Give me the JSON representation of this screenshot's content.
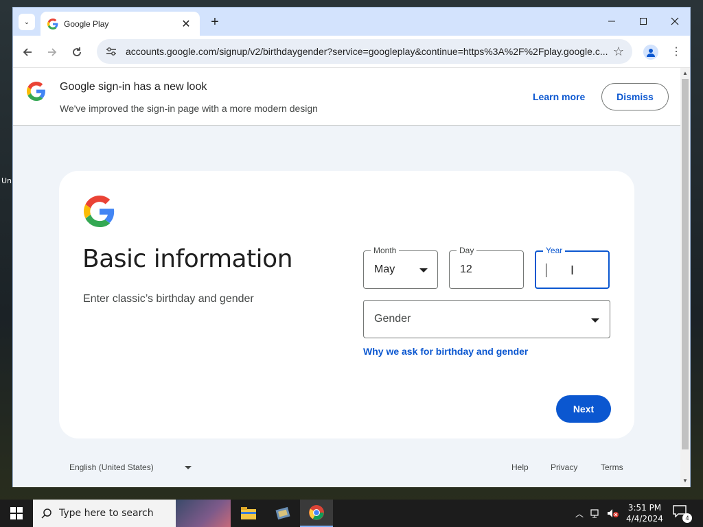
{
  "desktop": {
    "icon_label": "Un"
  },
  "browser": {
    "tab_title": "Google Play",
    "url": "accounts.google.com/signup/v2/birthdaygender?service=googleplay&continue=https%3A%2F%2Fplay.google.c..."
  },
  "banner": {
    "title": "Google sign-in has a new look",
    "subtitle": "We've improved the sign-in page with a more modern design",
    "learn_more": "Learn more",
    "dismiss": "Dismiss"
  },
  "card": {
    "title": "Basic information",
    "subtitle": "Enter classic’s birthday and gender",
    "month": {
      "label": "Month",
      "value": "May"
    },
    "day": {
      "label": "Day",
      "value": "12"
    },
    "year": {
      "label": "Year",
      "value": ""
    },
    "gender": {
      "placeholder": "Gender"
    },
    "why_link": "Why we ask for birthday and gender",
    "next": "Next"
  },
  "footer": {
    "language": "English (United States)",
    "help": "Help",
    "privacy": "Privacy",
    "terms": "Terms"
  },
  "taskbar": {
    "search_placeholder": "Type here to search",
    "time": "3:51 PM",
    "date": "4/4/2024",
    "notification_count": "4"
  },
  "colors": {
    "accent": "#0b57d0",
    "page_bg": "#f0f4f9",
    "tabstrip_bg": "#d3e3fd"
  }
}
